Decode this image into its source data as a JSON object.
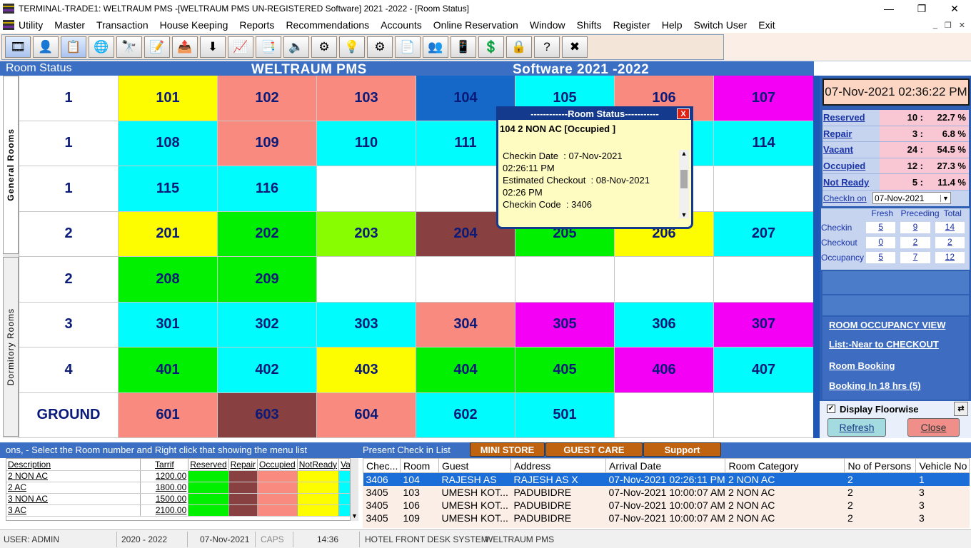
{
  "window": {
    "title": "TERMINAL-TRADE1: WELTRAUM PMS -[WELTRAUM PMS UN-REGISTERED Software] 2021 -2022 - [Room Status]",
    "min": "—",
    "max": "❐",
    "close": "✕"
  },
  "menu": [
    "Utility",
    "Master",
    "Transaction",
    "House Keeping",
    "Reports",
    "Recommendations",
    "Accounts",
    "Online Reservation",
    "Window",
    "Shifts",
    "Register",
    "Help",
    "Switch User",
    "Exit"
  ],
  "toolbar_icons": [
    "🎞",
    "👤",
    "📋",
    "🌐",
    "🔭",
    "📝",
    "📤",
    "⬇",
    "📈",
    "📑",
    "🔈",
    "⚙",
    "💡",
    "⚙",
    "📄",
    "👥",
    "📱",
    "💲",
    "🔒",
    "?",
    "✖"
  ],
  "header": {
    "section": "Room Status",
    "brand1": "WELTRAUM PMS",
    "brand2": "Software 2021 -2022"
  },
  "tabs": {
    "general": "General Rooms",
    "dormitory": "Dormitory Rooms"
  },
  "grid": [
    [
      "1",
      "101",
      "102",
      "103",
      "104",
      "105",
      "106",
      "107"
    ],
    [
      "1",
      "108",
      "109",
      "110",
      "111",
      "",
      "",
      "114"
    ],
    [
      "1",
      "115",
      "116",
      "",
      "",
      "",
      "",
      ""
    ],
    [
      "2",
      "201",
      "202",
      "203",
      "204",
      "205",
      "206",
      "207"
    ],
    [
      "2",
      "208",
      "209",
      "",
      "",
      "",
      "",
      ""
    ],
    [
      "3",
      "301",
      "302",
      "303",
      "304",
      "305",
      "306",
      "307"
    ],
    [
      "4",
      "401",
      "402",
      "403",
      "404",
      "405",
      "406",
      "407"
    ],
    [
      "GROUND",
      "601",
      "603",
      "604",
      "602",
      "501",
      "",
      ""
    ]
  ],
  "grid_colors": [
    [
      "#ffffff",
      "#fdfd00",
      "#f88a80",
      "#f88a80",
      "#1568c8",
      "#00fcfc",
      "#f88a80",
      "#f400f4"
    ],
    [
      "#ffffff",
      "#00fcfc",
      "#f88a80",
      "#00fcfc",
      "#00fcfc",
      "#00fcfc",
      "#00fcfc",
      "#00fcfc"
    ],
    [
      "#ffffff",
      "#00fcfc",
      "#00fcfc",
      "#ffffff",
      "#ffffff",
      "#ffffff",
      "#ffffff",
      "#ffffff"
    ],
    [
      "#ffffff",
      "#fdfd00",
      "#00f000",
      "#88fc00",
      "#884040",
      "#00f000",
      "#fdfd00",
      "#00fcfc"
    ],
    [
      "#ffffff",
      "#00f000",
      "#00f000",
      "#ffffff",
      "#ffffff",
      "#ffffff",
      "#ffffff",
      "#ffffff"
    ],
    [
      "#ffffff",
      "#00fcfc",
      "#00fcfc",
      "#00fcfc",
      "#f88a80",
      "#f400f4",
      "#00fcfc",
      "#f400f4"
    ],
    [
      "#ffffff",
      "#00f000",
      "#00fcfc",
      "#fdfd00",
      "#00f000",
      "#00f000",
      "#f400f4",
      "#00fcfc"
    ],
    [
      "#ffffff",
      "#f88a80",
      "#884040",
      "#f88a80",
      "#00fcfc",
      "#00fcfc",
      "#ffffff",
      "#ffffff"
    ]
  ],
  "datetime": "07-Nov-2021 02:36:22 PM",
  "stats": [
    {
      "label": "Reserved",
      "count": "10 :",
      "pct": "22.7 %"
    },
    {
      "label": "Repair",
      "count": "3 :",
      "pct": "6.8 %"
    },
    {
      "label": "Vacant",
      "count": "24 :",
      "pct": "54.5 %"
    },
    {
      "label": "Occupied",
      "count": "12 :",
      "pct": "27.3 %"
    },
    {
      "label": "Not Ready",
      "count": "5 :",
      "pct": "11.4 %"
    }
  ],
  "checkin_on": {
    "label": "CheckIn on",
    "value": "07-Nov-2021"
  },
  "flow": {
    "headers": [
      "Fresh",
      "Preceding",
      "Total"
    ],
    "rows": [
      {
        "name": "Checkin",
        "values": [
          "5",
          "9",
          "14"
        ]
      },
      {
        "name": "Checkout",
        "values": [
          "0",
          "2",
          "2"
        ]
      },
      {
        "name": "Occupancy",
        "values": [
          "5",
          "7",
          "12"
        ]
      }
    ]
  },
  "links": [
    "ROOM OCCUPANCY VIEW",
    "List:-Near to CHECKOUT",
    "Room Booking",
    "Booking In 18 hrs (5)"
  ],
  "display_floorwise": "Display Floorwise",
  "buttons": {
    "refresh": "Refresh",
    "close": "Close"
  },
  "popup": {
    "title": "------------Room Status-----------",
    "close": "X",
    "line1": "104     2 NON AC      [Occupied ]",
    "body": "Checkin Date  : 07-Nov-2021\n02:26:11 PM\nEstimated Checkout  : 08-Nov-2021\n02:26 PM\nCheckin Code  : 3406"
  },
  "hint": "ons, - Select the Room number and  Right click  that  showing the menu list",
  "present_list": "Present Check in List",
  "bottom_tabs": [
    "MINI STORE",
    "GUEST CARE",
    "Support"
  ],
  "tariff": {
    "headers": [
      "Description",
      "Tarrif",
      "Reserved",
      "Repair",
      "Occupied",
      "NotReady",
      "Vac"
    ],
    "rows": [
      {
        "desc": "2 NON AC",
        "tarrif": "1200.00"
      },
      {
        "desc": "2 AC",
        "tarrif": "1800.00"
      },
      {
        "desc": "3 NON AC",
        "tarrif": "1500.00"
      },
      {
        "desc": "3 AC",
        "tarrif": "2100.00"
      }
    ]
  },
  "checkins": {
    "headers": [
      "Chec...",
      "Room",
      "Guest",
      "Address",
      "Arrival Date",
      "Room Category",
      "No of Persons",
      "Vehicle No"
    ],
    "rows": [
      [
        "3406",
        "104",
        "RAJESH AS",
        "RAJESH AS X",
        "07-Nov-2021 02:26:11 PM",
        "2 NON AC",
        "2",
        "1"
      ],
      [
        "3405",
        "103",
        "UMESH KOT...",
        "PADUBIDRE",
        "07-Nov-2021 10:00:07 AM",
        "2 NON AC",
        "2",
        "3"
      ],
      [
        "3405",
        "106",
        "UMESH KOT...",
        "PADUBIDRE",
        "07-Nov-2021 10:00:07 AM",
        "2 NON AC",
        "2",
        "3"
      ],
      [
        "3405",
        "109",
        "UMESH KOT...",
        "PADUBIDRE",
        "07-Nov-2021 10:00:07 AM",
        "2 NON AC",
        "2",
        "3"
      ]
    ]
  },
  "status": {
    "user": "USER: ADMIN",
    "year": "2020 - 2022",
    "date": "07-Nov-2021",
    "caps": "CAPS",
    "time": "14:36",
    "system": "HOTEL FRONT DESK SYSTEM",
    "brand": "WELTRAUM PMS"
  }
}
